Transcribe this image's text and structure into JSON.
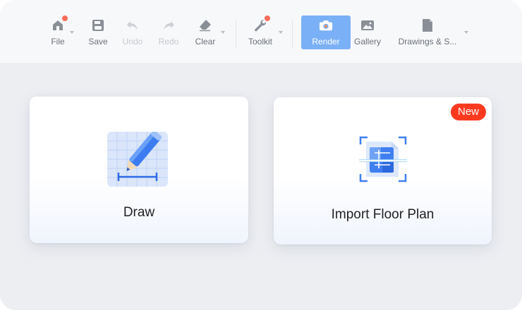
{
  "toolbar": {
    "file": {
      "label": "File",
      "icon": "home-icon"
    },
    "save": {
      "label": "Save",
      "icon": "save-icon"
    },
    "undo": {
      "label": "Undo",
      "icon": "undo-icon"
    },
    "redo": {
      "label": "Redo",
      "icon": "redo-icon"
    },
    "clear": {
      "label": "Clear",
      "icon": "eraser-icon"
    },
    "toolkit": {
      "label": "Toolkit",
      "icon": "wrench-icon"
    },
    "render": {
      "label": "Render",
      "icon": "camera-icon"
    },
    "gallery": {
      "label": "Gallery",
      "icon": "image-icon"
    },
    "drawings": {
      "label": "Drawings & S...",
      "icon": "document-icon"
    }
  },
  "cards": {
    "draw": {
      "title": "Draw",
      "icon": "pencil-grid-icon"
    },
    "import": {
      "title": "Import Floor Plan",
      "icon": "floor-plan-scan-icon",
      "badge": "New"
    }
  },
  "colors": {
    "accent": "#7ab0f5",
    "badge": "#ff3a1f",
    "notify_dot": "#ff6b5a"
  }
}
